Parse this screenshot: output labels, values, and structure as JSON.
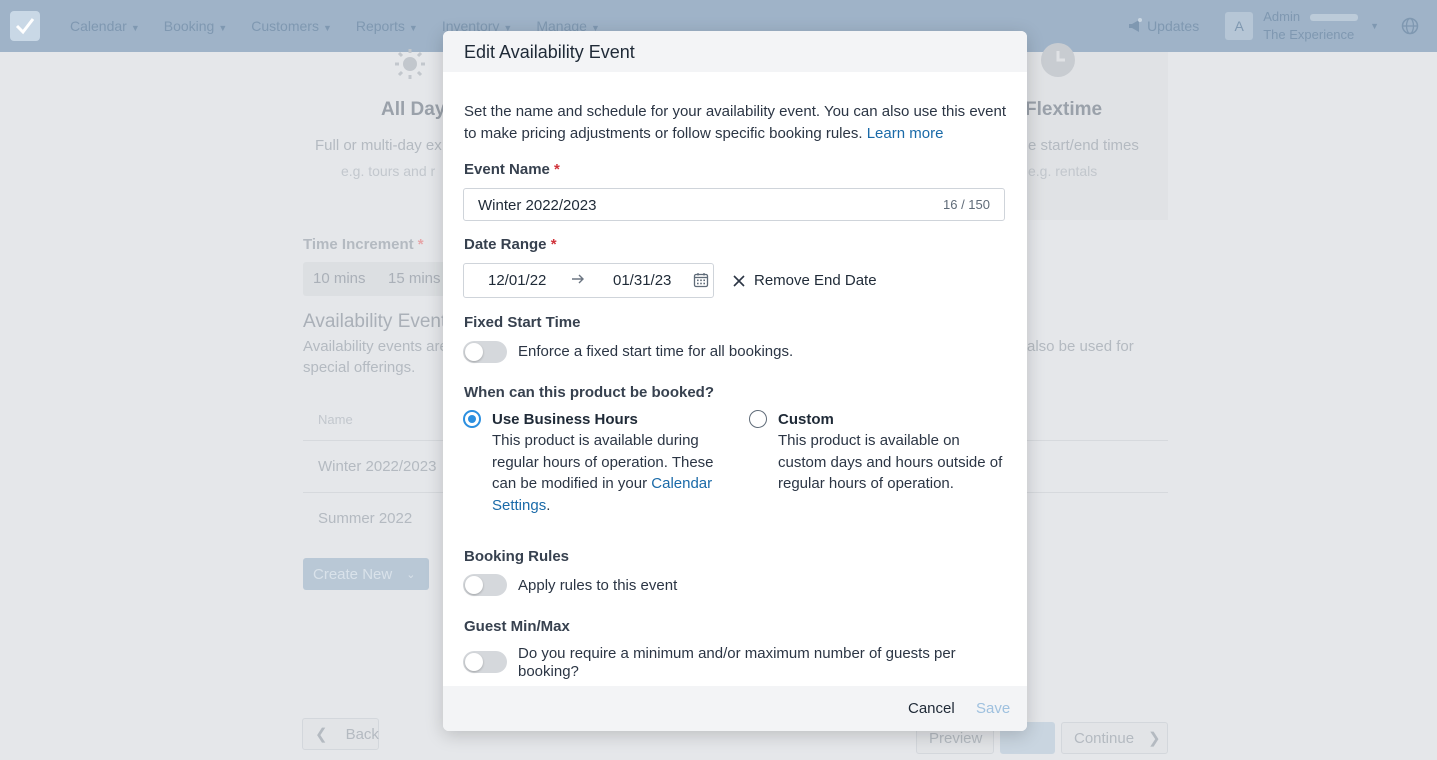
{
  "nav": {
    "items": [
      "Calendar",
      "Booking",
      "Customers",
      "Reports",
      "Inventory",
      "Manage"
    ],
    "updates_label": "Updates",
    "avatar_initial": "A",
    "user_role": "Admin",
    "user_company": "The Experience"
  },
  "background": {
    "all_day_title": "All Day",
    "all_day_desc": "Full or multi-day ex",
    "all_day_example": "e.g. tours and r",
    "flextime_title": "Flextime",
    "flextime_desc": "e start/end times",
    "flextime_example": "e.g. rentals",
    "time_increment_label": "Time Increment",
    "time_increment_required": "*",
    "increment_options": [
      "10 mins",
      "15 mins"
    ],
    "section_title": "Availability Events",
    "section_desc_line1": "Availability events are",
    "section_desc_line2": "special offerings.",
    "section_desc_right": "also be used for",
    "table_header_name": "Name",
    "rows": [
      "Winter 2022/2023",
      "Summer 2022"
    ],
    "create_new_label": "Create New",
    "back_label": "Back",
    "preview_label": "Preview",
    "continue_label": "Continue"
  },
  "modal": {
    "title": "Edit Availability Event",
    "intro_text": "Set the name and schedule for your availability event. You can also use this event to make pricing adjustments or follow specific booking rules.",
    "learn_more": "Learn more",
    "event_name_label": "Event Name",
    "required_mark": "*",
    "event_name_value": "Winter 2022/2023",
    "char_count": "16 / 150",
    "date_range_label": "Date Range",
    "start_date": "12/01/22",
    "end_date": "01/31/23",
    "remove_end_date": "Remove End Date",
    "fixed_start_label": "Fixed Start Time",
    "fixed_start_text": "Enforce a fixed start time for all bookings.",
    "when_label": "When can this product be booked?",
    "option_business_title": "Use Business Hours",
    "option_business_desc": "This product is available during regular hours of operation. These can be modified in your",
    "calendar_settings_link": "Calendar Settings",
    "period": ".",
    "option_custom_title": "Custom",
    "option_custom_desc": "This product is available on custom days and hours outside of regular hours of operation.",
    "booking_rules_label": "Booking Rules",
    "booking_rules_text": "Apply rules to this event",
    "guest_minmax_label": "Guest Min/Max",
    "guest_minmax_text": "Do you require a minimum and/or maximum number of guests per booking?",
    "cancel_label": "Cancel",
    "save_label": "Save"
  },
  "colors": {
    "accent": "#2b8fe0",
    "link": "#1a6aa8",
    "required": "#d0323a"
  }
}
